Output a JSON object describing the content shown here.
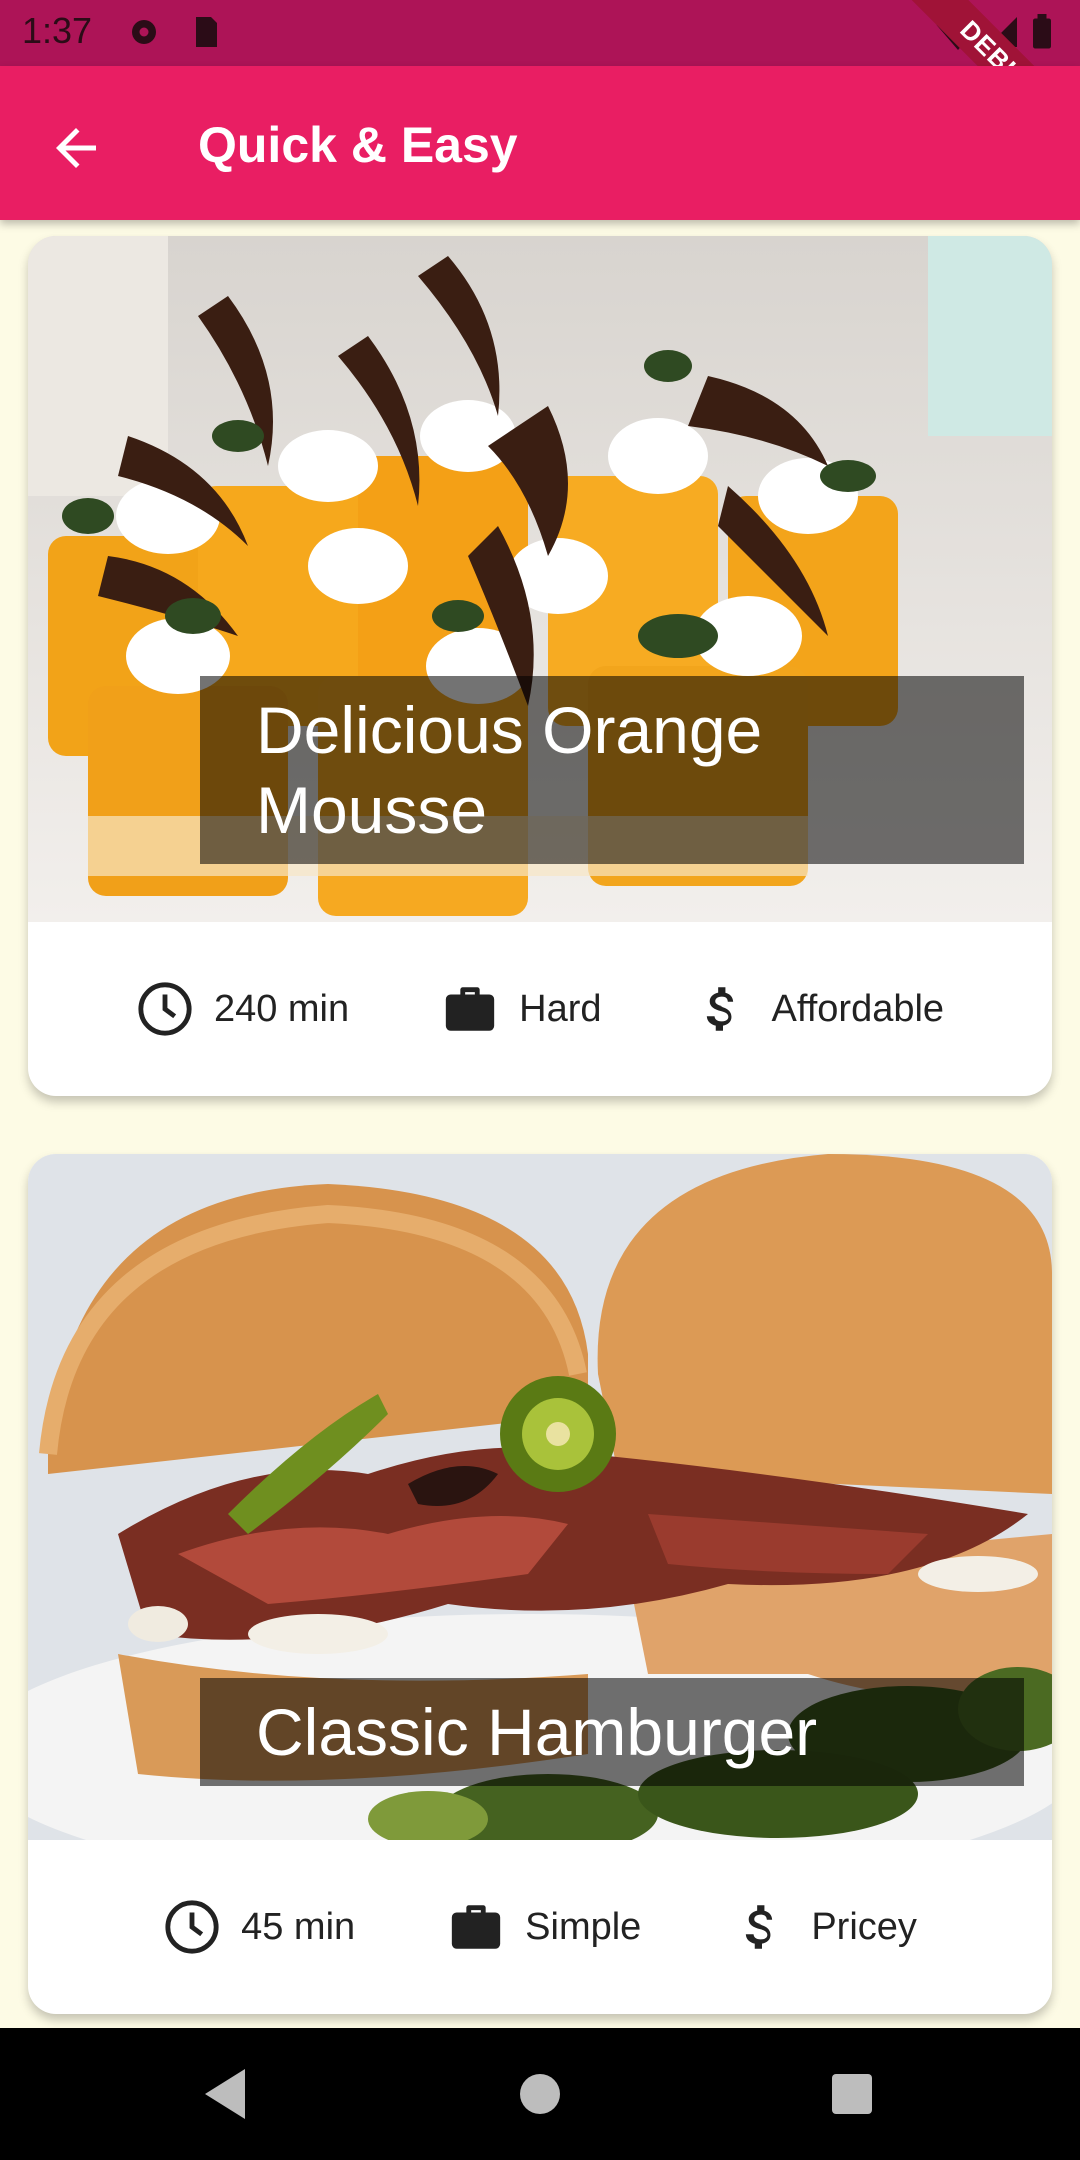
{
  "status_bar": {
    "time": "1:37",
    "debug_label": "DEBUG"
  },
  "app_bar": {
    "title": "Quick & Easy",
    "back_icon": "arrow-back-icon"
  },
  "meals": [
    {
      "title": "Delicious Orange Mousse",
      "duration": "240 min",
      "complexity": "Hard",
      "affordability": "Affordable"
    },
    {
      "title": "Classic Hamburger",
      "duration": "45 min",
      "complexity": "Simple",
      "affordability": "Pricey"
    }
  ],
  "icons": {
    "duration": "clock-icon",
    "complexity": "briefcase-icon",
    "affordability": "dollar-icon"
  },
  "colors": {
    "status_bar": "#ad1457",
    "app_bar": "#e91e63",
    "background": "#fdfbe5",
    "nav_bar": "#000000"
  }
}
